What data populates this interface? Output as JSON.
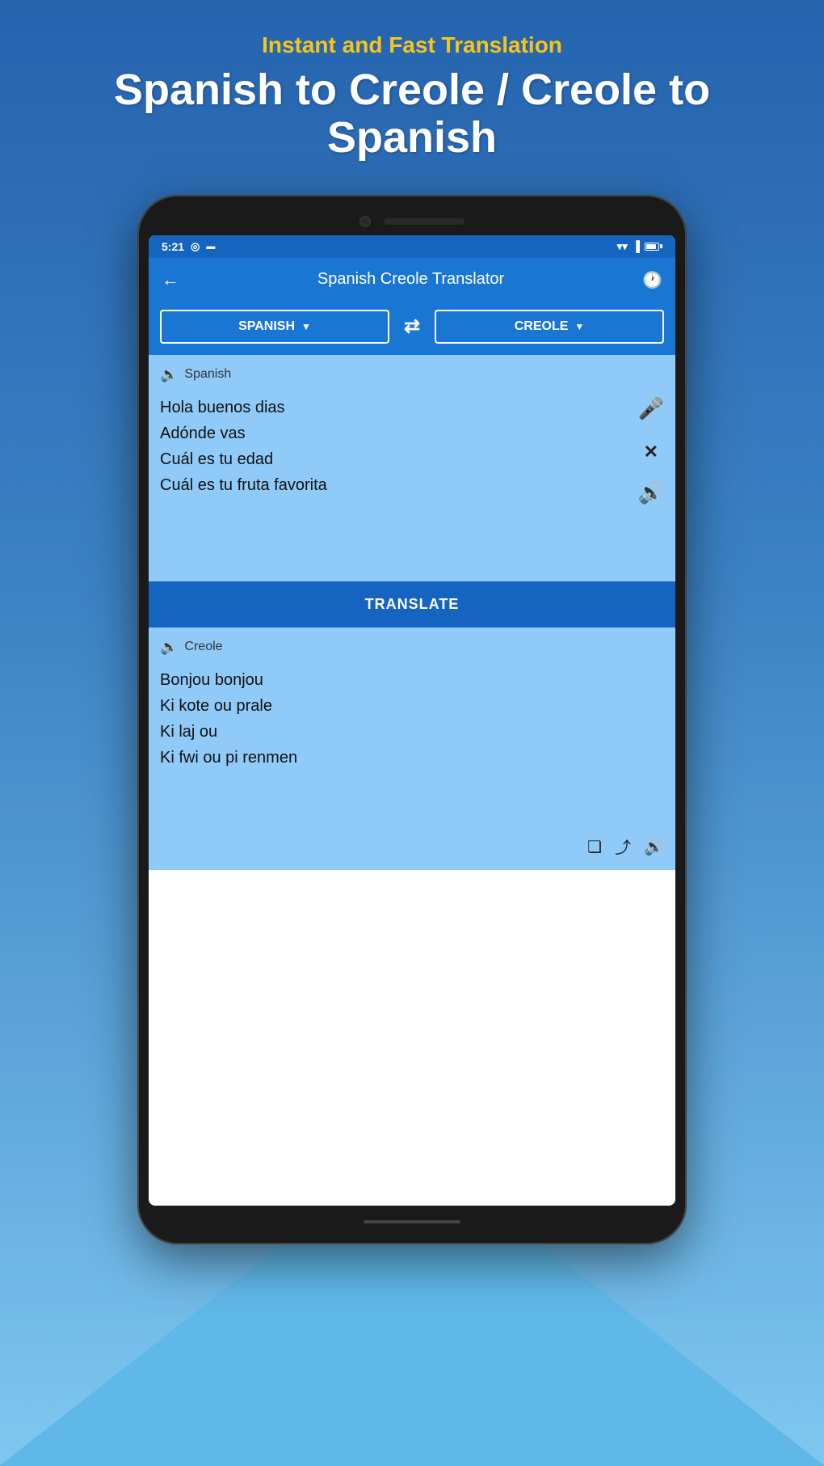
{
  "background": {
    "gradient_start": "#2563ae",
    "gradient_end": "#7ec8f0"
  },
  "header": {
    "tagline": "Instant and Fast Translation",
    "title": "Spanish to Creole / Creole to Spanish"
  },
  "status_bar": {
    "time": "5:21",
    "wifi": "▼",
    "signal": "▐",
    "battery_pct": 85
  },
  "app_bar": {
    "title": "Spanish Creole Translator",
    "back_icon": "←",
    "history_icon": "🕐"
  },
  "lang_selector": {
    "source_lang": "SPANISH",
    "target_lang": "CREOLE",
    "swap_icon": "⇄"
  },
  "input_panel": {
    "lang_label": "Spanish",
    "text_lines": [
      "Hola buenos dias",
      "Adónde vas",
      "Cuál es tu edad",
      "Cuál es tu fruta favorita"
    ],
    "mic_icon": "🎤",
    "clear_icon": "✕",
    "speaker_icon": "🔊"
  },
  "translate_button": {
    "label": "TRANSLATE"
  },
  "output_panel": {
    "lang_label": "Creole",
    "text_lines": [
      "Bonjou bonjou",
      "Ki kote ou prale",
      "Ki laj ou",
      "Ki fwi ou pi renmen"
    ],
    "copy_icon": "❏",
    "share_icon": "⤴",
    "speaker_icon": "🔊"
  }
}
